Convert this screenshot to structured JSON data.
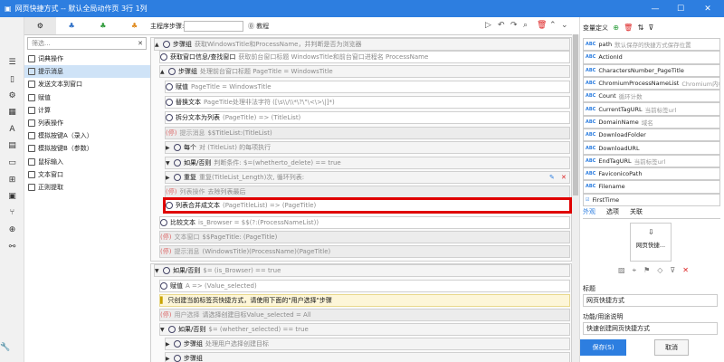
{
  "window": {
    "title": "网页快捷方式 -- 默认全局动作页 3行 1列",
    "minimize": "—",
    "maximize": "☐",
    "close": "✕"
  },
  "cmd_tabs": [
    "⚙",
    "♣",
    "♣",
    "♣"
  ],
  "filter": {
    "placeholder": "筛选...",
    "clear": "✕"
  },
  "commands": [
    "词典操作",
    "提示消息",
    "发送文本到窗口",
    "赋值",
    "计算",
    "列表操作",
    "模拟按键A（录入）",
    "模拟按键B（参数）",
    "鼠标输入",
    "文本窗口",
    "正则提取"
  ],
  "toolbar": {
    "label": "主程序步骤:",
    "help": "⓪ 教程"
  },
  "steps": [
    {
      "k": "步骤组",
      "d": "获取WindowsTitle和ProcessName，并判断是否为浏览器"
    },
    {
      "k": "获取窗口信息/查找窗口",
      "d": "获取前台窗口标题 WindowsTitle和前台窗口进程名 ProcessName"
    },
    {
      "k": "步骤组",
      "d": "处理前台窗口标题 PageTitle = WindowsTitle"
    },
    {
      "k": "赋值",
      "d": "PageTitle = WindowsTitle"
    },
    {
      "k": "替换文本",
      "d": "PageTitle处理非法字符 ([\\s\\\\/\\\\*\\?\\\"\\<\\>\\|]*)"
    },
    {
      "k": "拆分文本为列表",
      "d": "(PageTitle) => (TitleList)"
    },
    {
      "k": "提示消息",
      "d": "$$TitleList:(TitleList)",
      "tag": "(停)"
    },
    {
      "k": "每个",
      "d": "对 (TitleList) 的每项执行"
    },
    {
      "k": "如果/否则",
      "d": "判断条件: $=(whetherto_delete) == true"
    },
    {
      "k": "重复",
      "d": "重复(TitleList_Length)次, 循环列表:"
    },
    {
      "k": "列表操作",
      "d": "去除列表最后",
      "tag": "(停)"
    },
    {
      "k": "列表合并成文本",
      "d": "(PageTitleList) => (PageTitle)"
    },
    {
      "k": "比较文本",
      "d": "is_Browser = $$(?:(ProcessNameList))"
    },
    {
      "k": "文本窗口",
      "d": "$$PageTitle: (PageTitle)",
      "tag": "(停)"
    },
    {
      "k": "提示消息",
      "d": "(WindowsTitle)(ProcessName)(PageTitle)",
      "tag": "(停)"
    },
    {
      "k": "如果/否则",
      "d": "$= (is_Browser) == true"
    },
    {
      "k": "赋值",
      "d": "A => (Value_selected)"
    },
    {
      "k": "只创建当前标签页快捷方式，请使用下面的\"用户选择\"步骤",
      "d": ""
    },
    {
      "k": "用户选择",
      "d": "请选择创建目标Value_selected = All",
      "tag": "(停)"
    },
    {
      "k": "如果/否则",
      "d": "$= (whether_selected) == true"
    },
    {
      "k": "步骤组",
      "d": "处理用户选择创建目标"
    },
    {
      "k": "步骤组",
      "d": ""
    }
  ],
  "vars": {
    "header": "变量定义",
    "items": [
      {
        "n": "path",
        "d": "默认保存的快捷方式保存位置"
      },
      {
        "n": "ActionId",
        "d": ""
      },
      {
        "n": "CharactersNumber_PageTitle",
        "d": ""
      },
      {
        "n": "ChromiumProcessNameList",
        "d": "Chromium内核"
      },
      {
        "n": "Count",
        "d": "循环计数"
      },
      {
        "n": "CurrentTagURL",
        "d": "当前标签url"
      },
      {
        "n": "DomainName",
        "d": "域名"
      },
      {
        "n": "DownloadFolder",
        "d": ""
      },
      {
        "n": "DownloadURL",
        "d": ""
      },
      {
        "n": "EndTagURL",
        "d": "当前标签url"
      },
      {
        "n": "FaviconicoPath",
        "d": ""
      },
      {
        "n": "Filename",
        "d": ""
      },
      {
        "n": "FirstTime",
        "d": ""
      }
    ]
  },
  "right_tabs": [
    "外观",
    "选项",
    "关联"
  ],
  "thumb_label": "网页快捷...",
  "form": {
    "title_label": "标题",
    "title_value": "网页快捷方式",
    "desc_label": "功能/用途说明",
    "desc_value": "快速创建网页快捷方式"
  },
  "buttons": {
    "save": "保存(S)",
    "cancel": "取消"
  }
}
